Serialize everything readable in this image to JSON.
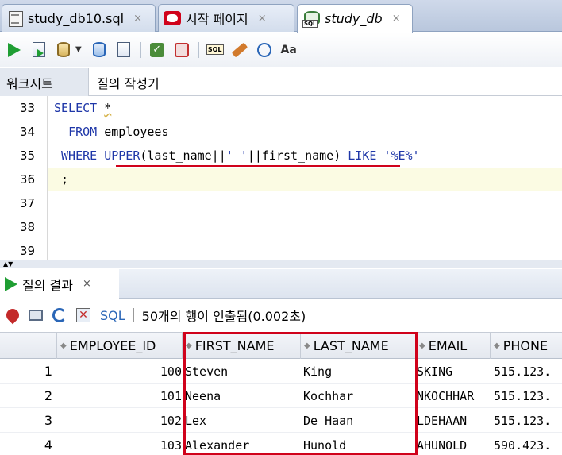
{
  "tabs": [
    {
      "label": "study_db10.sql",
      "close": "×",
      "icon": "sql-file-icon"
    },
    {
      "label": "시작 페이지",
      "close": "×",
      "icon": "oracle-icon"
    },
    {
      "label": "study_db",
      "close": "×",
      "icon": "db-connection-icon"
    }
  ],
  "toolbar": {
    "icons": [
      "run-statement-icon",
      "run-script-icon",
      "autotrace-icon",
      "explain-plan-icon",
      "sql-tuning-icon",
      "commit-icon",
      "rollback-icon",
      "unshared-sql-icon",
      "clear-icon",
      "history-icon",
      "format-icon"
    ]
  },
  "subtabs": {
    "worksheet": "워크시트",
    "query_builder": "질의 작성기"
  },
  "editor": {
    "lines": [
      {
        "num": "33",
        "code": "SELECT *"
      },
      {
        "num": "34",
        "code": "  FROM employees"
      },
      {
        "num": "35",
        "code": " WHERE UPPER(last_name||' '||first_name) LIKE '%E%'"
      },
      {
        "num": "36",
        "code": " ;"
      },
      {
        "num": "37",
        "code": ""
      },
      {
        "num": "38",
        "code": ""
      },
      {
        "num": "39",
        "code": ""
      }
    ]
  },
  "results": {
    "tab_label": "질의 결과",
    "tab_close": "×",
    "sql_link": "SQL",
    "status": "50개의 행이 인출됨(0.002초)",
    "columns": [
      "EMPLOYEE_ID",
      "FIRST_NAME",
      "LAST_NAME",
      "EMAIL",
      "PHONE"
    ],
    "rows": [
      {
        "n": "1",
        "employee_id": "100",
        "first_name": "Steven",
        "last_name": "King",
        "email": "SKING",
        "phone": "515.123."
      },
      {
        "n": "2",
        "employee_id": "101",
        "first_name": "Neena",
        "last_name": "Kochhar",
        "email": "NKOCHHAR",
        "phone": "515.123."
      },
      {
        "n": "3",
        "employee_id": "102",
        "first_name": "Lex",
        "last_name": "De Haan",
        "email": "LDEHAAN",
        "phone": "515.123."
      },
      {
        "n": "4",
        "employee_id": "103",
        "first_name": "Alexander",
        "last_name": "Hunold",
        "email": "AHUNOLD",
        "phone": "590.423."
      }
    ]
  },
  "colors": {
    "keyword": "#1f37a8",
    "annotation_red": "#d0021b",
    "current_line": "#fbfbe3"
  }
}
